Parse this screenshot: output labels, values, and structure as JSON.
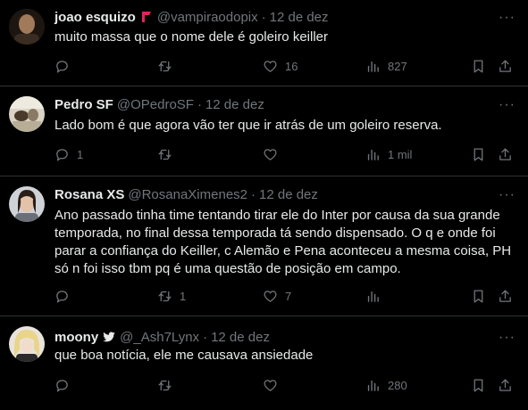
{
  "tweets": [
    {
      "name": "joao esquizo",
      "handle": "@vampiraodopix",
      "date": "12 de dez",
      "text": "muito massa que o nome dele é goleiro keiller",
      "counts": {
        "replies": "",
        "retweets": "",
        "likes": "16",
        "views": "827"
      },
      "badge_color": "#e0245e"
    },
    {
      "name": "Pedro SF",
      "handle": "@OPedroSF",
      "date": "12 de dez",
      "text": "Lado bom é que agora vão ter que ir atrás de um goleiro reserva.",
      "counts": {
        "replies": "1",
        "retweets": "",
        "likes": "",
        "views": "1 mil"
      }
    },
    {
      "name": "Rosana XS",
      "handle": "@RosanaXimenes2",
      "date": "12 de dez",
      "text": "Ano passado tinha time tentando tirar ele do Inter por causa da sua grande temporada, no final dessa temporada tá sendo dispensado. O q e onde foi parar a confiança do Keiller, c Alemão e Pena aconteceu a mesma coisa, PH só n foi isso tbm pq é uma questão de posição em campo.",
      "counts": {
        "replies": "",
        "retweets": "1",
        "likes": "7",
        "views": ""
      }
    },
    {
      "name": "moony",
      "handle": "@_Ash7Lynx",
      "date": "12 de dez",
      "text": "que boa notícia, ele me causava ansiedade",
      "counts": {
        "replies": "",
        "retweets": "",
        "likes": "",
        "views": "280"
      }
    }
  ],
  "separator": "·",
  "more_glyph": "···",
  "colors": {
    "background": "#000000",
    "text": "#e7e9ea",
    "muted": "#71767b",
    "divider": "#2f3336",
    "badge_red": "#e0245e"
  },
  "icons": [
    "reply-icon",
    "retweet-icon",
    "like-icon",
    "views-icon",
    "bookmark-icon",
    "share-icon",
    "more-icon",
    "verified-bird-icon",
    "flag-icon"
  ]
}
